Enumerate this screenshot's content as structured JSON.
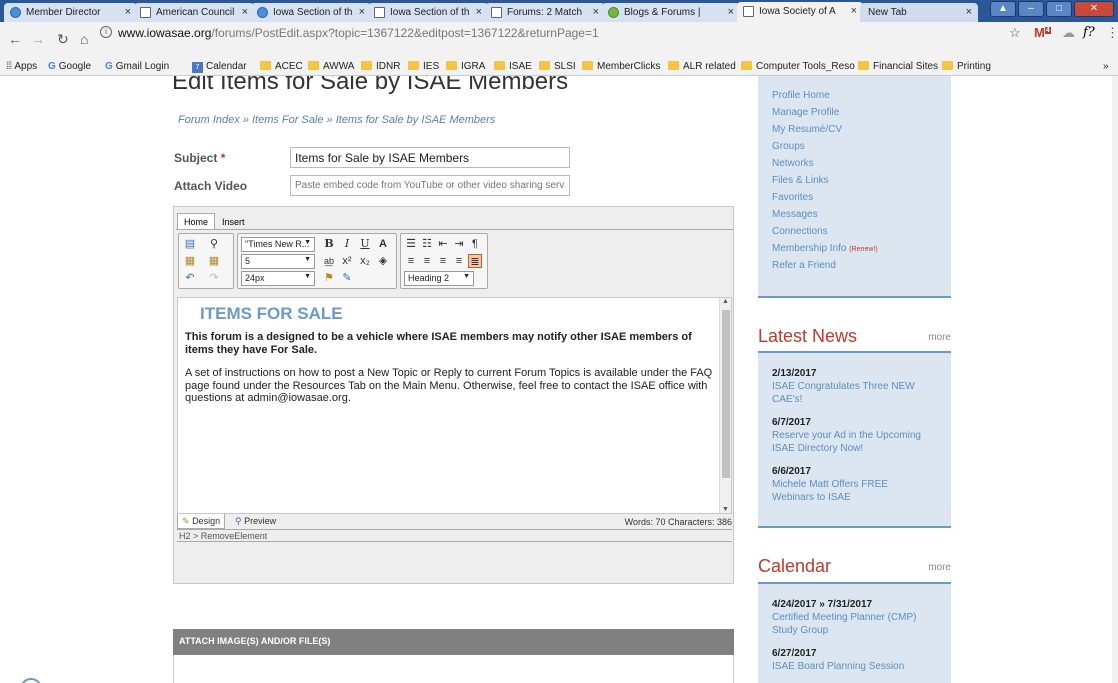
{
  "browser": {
    "tabs": [
      {
        "label": "Member Director",
        "icon": "globe"
      },
      {
        "label": "American Council",
        "icon": "page"
      },
      {
        "label": "Iowa Section of th",
        "icon": "globe"
      },
      {
        "label": "Iowa Section of th",
        "icon": "page"
      },
      {
        "label": "Forums: 2 Match",
        "icon": "page"
      },
      {
        "label": "Blogs & Forums |",
        "icon": "leaf"
      },
      {
        "label": "Iowa Society of A",
        "icon": "page"
      },
      {
        "label": "New Tab",
        "icon": "none"
      }
    ],
    "url_host": "www.iowasae.org",
    "url_path": "/forums/PostEdit.aspx?topic=1367122&editpost=1367122&returnPage=1",
    "bookmarks": [
      "Apps",
      "Google",
      "Gmail Login",
      "Calendar",
      "ACEC",
      "AWWA",
      "IDNR",
      "IES",
      "IGRA",
      "ISAE",
      "SLSI",
      "MemberClicks",
      "ALR related",
      "Computer Tools_Reso",
      "Financial Sites",
      "Printing"
    ],
    "more_bookmarks": "»",
    "calendar_day": "7",
    "mail_badge": "4"
  },
  "page": {
    "title": "Edit Items for Sale by ISAE Members",
    "breadcrumb": "Forum Index » Items For Sale » Items for Sale by ISAE Members",
    "subject_label": "Subject",
    "subject_required": "*",
    "subject_value": "Items for Sale by ISAE Members",
    "video_label": "Attach Video",
    "video_placeholder": "Paste embed code from YouTube or other video sharing service"
  },
  "editor": {
    "tabs": [
      "Home",
      "Insert"
    ],
    "font_family": "\"Times New R...",
    "font_size": "5",
    "line_height": "24px",
    "block_format": "Heading 2",
    "heading": "ITEMS FOR SALE",
    "intro": "This forum is a designed to be a vehicle where ISAE members may notify other ISAE members of items they have For Sale.",
    "body": "A set of instructions on how to post a New Topic or Reply to current Forum Topics is available under the FAQ page found under the Resources Tab on the Main Menu.  Otherwise, feel free to contact the ISAE office with questions at admin@iowasae.org.",
    "design_label": "Design",
    "preview_label": "Preview",
    "wordcount": "Words: 70  Characters: 386",
    "path": "H2 > RemoveElement"
  },
  "attach": {
    "label": "ATTACH IMAGE(S) AND/OR FILE(S)"
  },
  "sidebar": {
    "profile_links": [
      "Profile Home",
      "Manage Profile",
      "My Resumé/CV",
      "Groups",
      "Networks",
      "Files & Links",
      "Favorites",
      "Messages",
      "Connections",
      "Membership Info",
      "Refer a Friend"
    ],
    "renew": "(Renew!)",
    "news_title": "Latest News",
    "news_more": "more",
    "news": [
      {
        "date": "2/13/2017",
        "lines": [
          "ISAE Congratulates Three NEW",
          "CAE's!"
        ]
      },
      {
        "date": "6/7/2017",
        "lines": [
          "Reserve your Ad in the Upcoming",
          "ISAE Directory Now!"
        ]
      },
      {
        "date": "6/6/2017",
        "lines": [
          "Michele Matt Offers FREE",
          "Webinars to ISAE"
        ]
      }
    ],
    "calendar_title": "Calendar",
    "calendar_more": "more",
    "events": [
      {
        "date": "4/24/2017 » 7/31/2017",
        "lines": [
          "Certified Meeting Planner (CMP)",
          "Study Group"
        ]
      },
      {
        "date": "6/27/2017",
        "lines": [
          "ISAE Board Planning Session"
        ]
      }
    ]
  }
}
